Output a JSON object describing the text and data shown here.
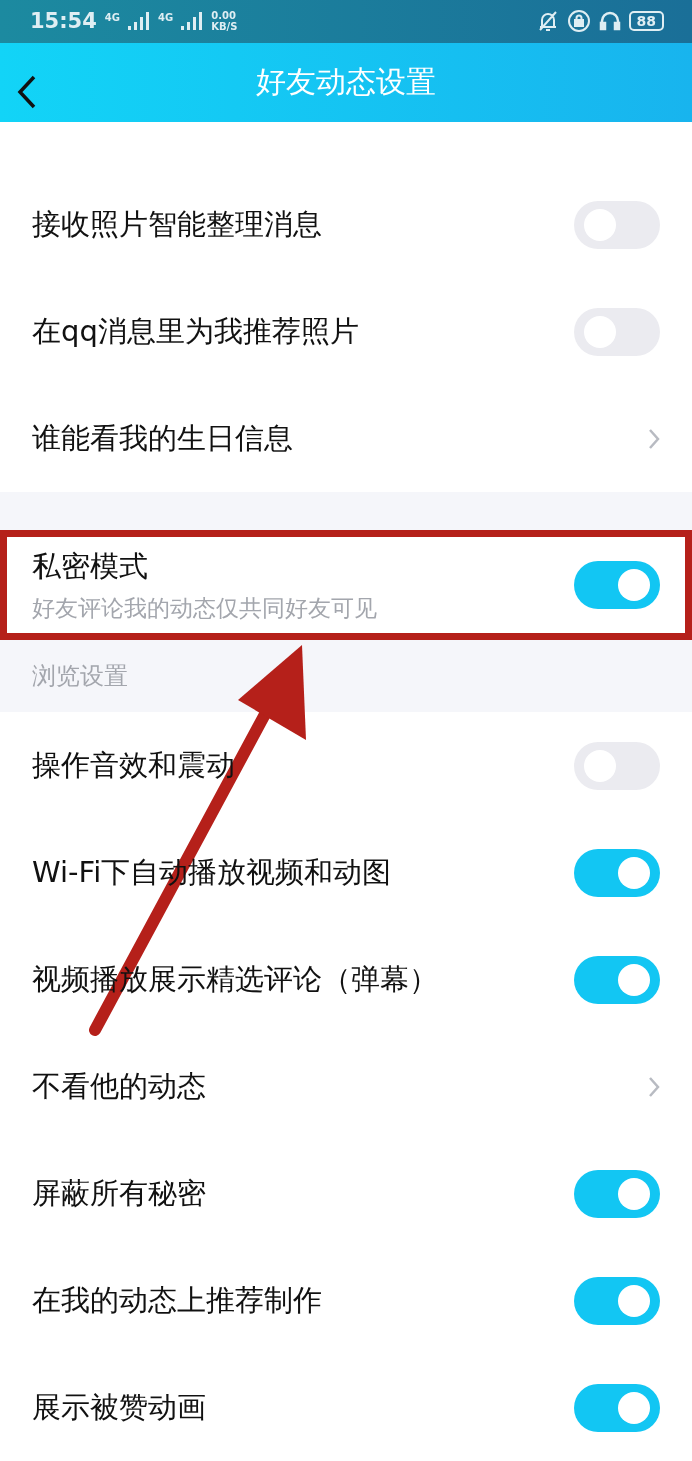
{
  "status_bar": {
    "time": "15:54",
    "network_1": "4G",
    "network_2": "4G",
    "speed_value": "0.00",
    "speed_unit": "KB/S",
    "battery": "88"
  },
  "header": {
    "title": "好友动态设置"
  },
  "sections": [
    {
      "rows": [
        {
          "kind": "toggle",
          "label": "接收照片智能整理消息",
          "on": false
        },
        {
          "kind": "toggle",
          "label": "在qq消息里为我推荐照片",
          "on": false
        },
        {
          "kind": "link",
          "label": "谁能看我的生日信息"
        }
      ]
    },
    {
      "rows": [
        {
          "kind": "toggle",
          "label": "私密模式",
          "sublabel": "好友评论我的动态仅共同好友可见",
          "on": true,
          "highlighted": true
        }
      ]
    },
    {
      "title": "浏览设置",
      "rows": [
        {
          "kind": "toggle",
          "label": "操作音效和震动",
          "on": false
        },
        {
          "kind": "toggle",
          "label": "Wi-Fi下自动播放视频和动图",
          "on": true
        },
        {
          "kind": "toggle",
          "label": "视频播放展示精选评论（弹幕）",
          "on": true
        },
        {
          "kind": "link",
          "label": "不看他的动态"
        },
        {
          "kind": "toggle",
          "label": "屏蔽所有秘密",
          "on": true
        },
        {
          "kind": "toggle",
          "label": "在我的动态上推荐制作",
          "on": true
        },
        {
          "kind": "toggle",
          "label": "展示被赞动画",
          "on": true
        }
      ]
    }
  ],
  "annotation_arrow": {
    "color": "#b5201a"
  }
}
